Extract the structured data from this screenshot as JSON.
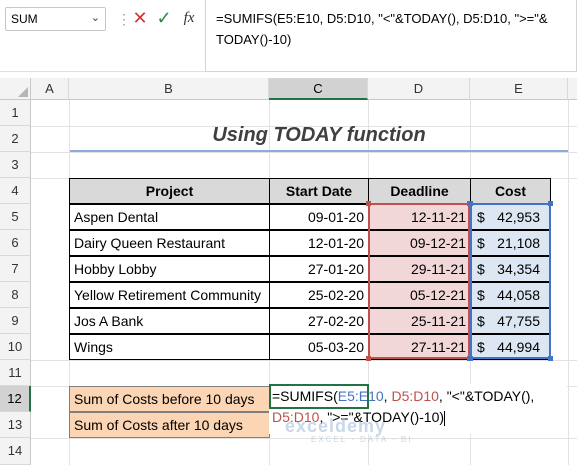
{
  "formula_bar": {
    "name_box": "SUM",
    "cancel_symbol": "✕",
    "enter_symbol": "✓",
    "fx_label": "fx",
    "formula": "=SUMIFS(E5:E10, D5:D10, \"<\"&TODAY(), D5:D10, \">=\"& TODAY()-10)"
  },
  "columns": [
    "A",
    "B",
    "C",
    "D",
    "E"
  ],
  "rows": [
    "1",
    "2",
    "3",
    "4",
    "5",
    "6",
    "7",
    "8",
    "9",
    "10",
    "11",
    "12",
    "13",
    "14"
  ],
  "title": "Using TODAY function",
  "table": {
    "headers": [
      "Project",
      "Start Date",
      "Deadline",
      "Cost"
    ],
    "rows": [
      {
        "project": "Aspen Dental",
        "start": "09-01-20",
        "deadline": "12-11-21",
        "cost": "42,953"
      },
      {
        "project": "Dairy Queen Restaurant",
        "start": "12-01-20",
        "deadline": "09-12-21",
        "cost": "21,108"
      },
      {
        "project": "Hobby Lobby",
        "start": "27-01-20",
        "deadline": "29-11-21",
        "cost": "34,354"
      },
      {
        "project": "Yellow Retirement Community",
        "start": "25-02-20",
        "deadline": "05-12-21",
        "cost": "44,058"
      },
      {
        "project": "Jos A Bank",
        "start": "27-02-20",
        "deadline": "25-11-21",
        "cost": "47,755"
      },
      {
        "project": "Wings",
        "start": "05-03-20",
        "deadline": "27-11-21",
        "cost": "44,994"
      }
    ],
    "currency": "$"
  },
  "summary": {
    "before_label": "Sum of Costs before 10 days",
    "after_label": "Sum of Costs after 10 days"
  },
  "editing_cell": {
    "p1": "=SUMIFS(",
    "ref1": "E5:E10",
    "p2": ", ",
    "ref2": "D5:D10",
    "p3": ", \"<\"&TODAY(), ",
    "ref3": "D5:D10",
    "p4": ", \">=\"&TODAY()-10)"
  },
  "watermark": {
    "brand": "exceldemy",
    "tagline": "EXCEL · DATA · BI"
  },
  "colors": {
    "ref1": "#4472c4",
    "ref2": "#c0504d",
    "ref3": "#7030a0",
    "accent": "#217346"
  }
}
